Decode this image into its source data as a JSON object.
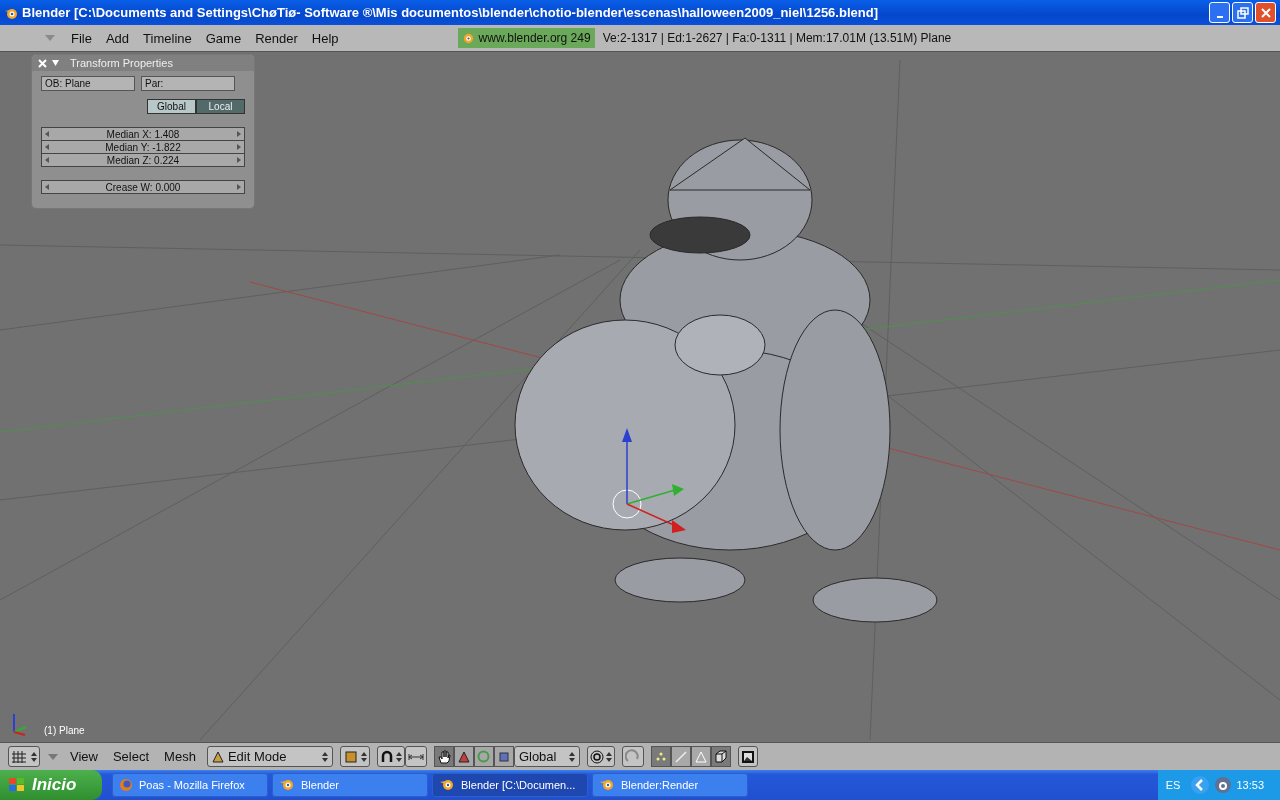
{
  "window": {
    "title": "Blender [C:\\Documents and Settings\\ChøTiø- Software ®\\Mis documentos\\blender\\chotio-blender\\escenas\\halloween2009_niel\\1256.blend]"
  },
  "menu": [
    "File",
    "Add",
    "Timeline",
    "Game",
    "Render",
    "Help"
  ],
  "info": {
    "site": "www.blender.org 249",
    "stats": "Ve:2-1317 | Ed:1-2627 | Fa:0-1311 | Mem:17.01M (13.51M) Plane"
  },
  "panel": {
    "title": "Transform Properties",
    "object_field": "OB: Plane",
    "parent_field": "Par:",
    "toggles": [
      {
        "label": "Global",
        "selected": false
      },
      {
        "label": "Local",
        "selected": true
      }
    ],
    "median_fields": [
      "Median X: 1.408",
      "Median Y: -1.822",
      "Median Z: 0.224"
    ],
    "crease_field": "Crease W: 0.000"
  },
  "viewport": {
    "object_label": "(1) Plane"
  },
  "header": {
    "menus": [
      "View",
      "Select",
      "Mesh"
    ],
    "mode": "Edit Mode",
    "orientation": "Global",
    "manipulators": [
      {
        "kind": "hand",
        "selected": true
      },
      {
        "kind": "translate",
        "selected": false
      },
      {
        "kind": "rotate",
        "selected": false
      },
      {
        "kind": "scale",
        "selected": false
      }
    ],
    "select_modes": [
      {
        "kind": "vertex",
        "selected": true
      },
      {
        "kind": "edge",
        "selected": false
      },
      {
        "kind": "face",
        "selected": false
      },
      {
        "kind": "occlude",
        "selected": true
      }
    ]
  },
  "taskbar": {
    "start": "Inicio",
    "tasks": [
      {
        "label": "Poas - Mozilla Firefox",
        "kind": "firefox",
        "selected": false
      },
      {
        "label": "Blender",
        "kind": "blender",
        "selected": false
      },
      {
        "label": "Blender [C:\\Documen...",
        "kind": "blender",
        "selected": true
      },
      {
        "label": "Blender:Render",
        "kind": "blender",
        "selected": false
      }
    ],
    "language": "ES",
    "clock": "13:53"
  }
}
